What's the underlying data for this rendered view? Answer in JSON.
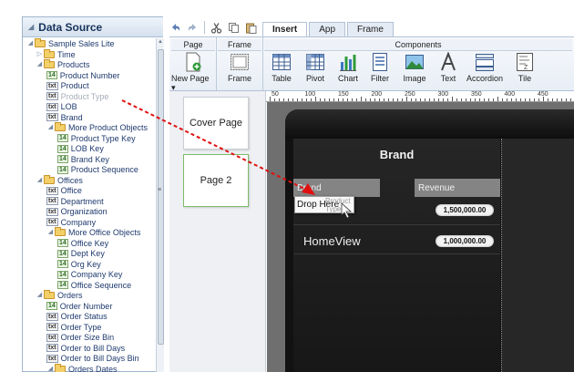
{
  "data_source": {
    "title": "Data Source",
    "tree": [
      {
        "label": "Sample Sales Lite",
        "kind": "folder",
        "twisty": "open",
        "dim": false
      },
      {
        "label": "Time",
        "kind": "folder",
        "twisty": "closed",
        "dim": false
      },
      {
        "label": "Products",
        "kind": "folder",
        "twisty": "open",
        "dim": false
      },
      {
        "label": "Product Number",
        "kind": "num",
        "dim": false
      },
      {
        "label": "Product",
        "kind": "txt",
        "dim": false
      },
      {
        "label": "Product Type",
        "kind": "txt",
        "dim": true
      },
      {
        "label": "LOB",
        "kind": "txt",
        "dim": false
      },
      {
        "label": "Brand",
        "kind": "txt",
        "dim": false
      },
      {
        "label": "More Product Objects",
        "kind": "folder",
        "twisty": "open",
        "dim": false
      },
      {
        "label": "Product Type Key",
        "kind": "num",
        "dim": false
      },
      {
        "label": "LOB Key",
        "kind": "num",
        "dim": false
      },
      {
        "label": "Brand Key",
        "kind": "num",
        "dim": false
      },
      {
        "label": "Product Sequence",
        "kind": "num",
        "dim": false
      },
      {
        "label": "Offices",
        "kind": "folder",
        "twisty": "open",
        "dim": false
      },
      {
        "label": "Office",
        "kind": "txt",
        "dim": false
      },
      {
        "label": "Department",
        "kind": "txt",
        "dim": false
      },
      {
        "label": "Organization",
        "kind": "txt",
        "dim": false
      },
      {
        "label": "Company",
        "kind": "txt",
        "dim": false
      },
      {
        "label": "More Office Objects",
        "kind": "folder",
        "twisty": "open",
        "dim": false
      },
      {
        "label": "Office Key",
        "kind": "num",
        "dim": false
      },
      {
        "label": "Dept Key",
        "kind": "num",
        "dim": false
      },
      {
        "label": "Org Key",
        "kind": "num",
        "dim": false
      },
      {
        "label": "Company Key",
        "kind": "num",
        "dim": false
      },
      {
        "label": "Office Sequence",
        "kind": "num",
        "dim": false
      },
      {
        "label": "Orders",
        "kind": "folder",
        "twisty": "open",
        "dim": false
      },
      {
        "label": "Order Number",
        "kind": "num",
        "dim": false
      },
      {
        "label": "Order Status",
        "kind": "txt",
        "dim": false
      },
      {
        "label": "Order Type",
        "kind": "txt",
        "dim": false
      },
      {
        "label": "Order Size Bin",
        "kind": "txt",
        "dim": false
      },
      {
        "label": "Order to Bill Days",
        "kind": "txt",
        "dim": false
      },
      {
        "label": "Order to Bill Days Bin",
        "kind": "txt",
        "dim": false
      },
      {
        "label": "Orders Dates",
        "kind": "folder",
        "twisty": "open",
        "dim": false
      }
    ],
    "badge_txt": "txt",
    "badge_num": "14"
  },
  "ribbon": {
    "tabs": [
      "Insert",
      "App",
      "Frame"
    ],
    "active_tab": "Insert",
    "groups": {
      "page": "Page",
      "frame": "Frame",
      "components": "Components"
    },
    "buttons": {
      "new_page": "New Page",
      "frame": "Frame",
      "table": "Table",
      "pivot": "Pivot",
      "chart": "Chart",
      "filter": "Filter",
      "image": "Image",
      "text": "Text",
      "accordion": "Accordion",
      "tile": "Tile"
    }
  },
  "ruler_numbers": [
    "50",
    "100",
    "150",
    "200",
    "250",
    "300",
    "350",
    "400",
    "450"
  ],
  "pages": [
    "Cover Page",
    "Page 2"
  ],
  "canvas": {
    "brand_title": "Brand",
    "col_brand": "Brand",
    "col_revenue": "Revenue",
    "row1_value": "1,500,000.00",
    "row2_label": "HomeView",
    "row2_value": "1,000,000.00"
  },
  "drop_hint": {
    "text": "Drop Here",
    "ghost": "Product Type"
  },
  "colors": {
    "drag_arrow": "#e01010",
    "accent_green": "#7dbb6b"
  }
}
